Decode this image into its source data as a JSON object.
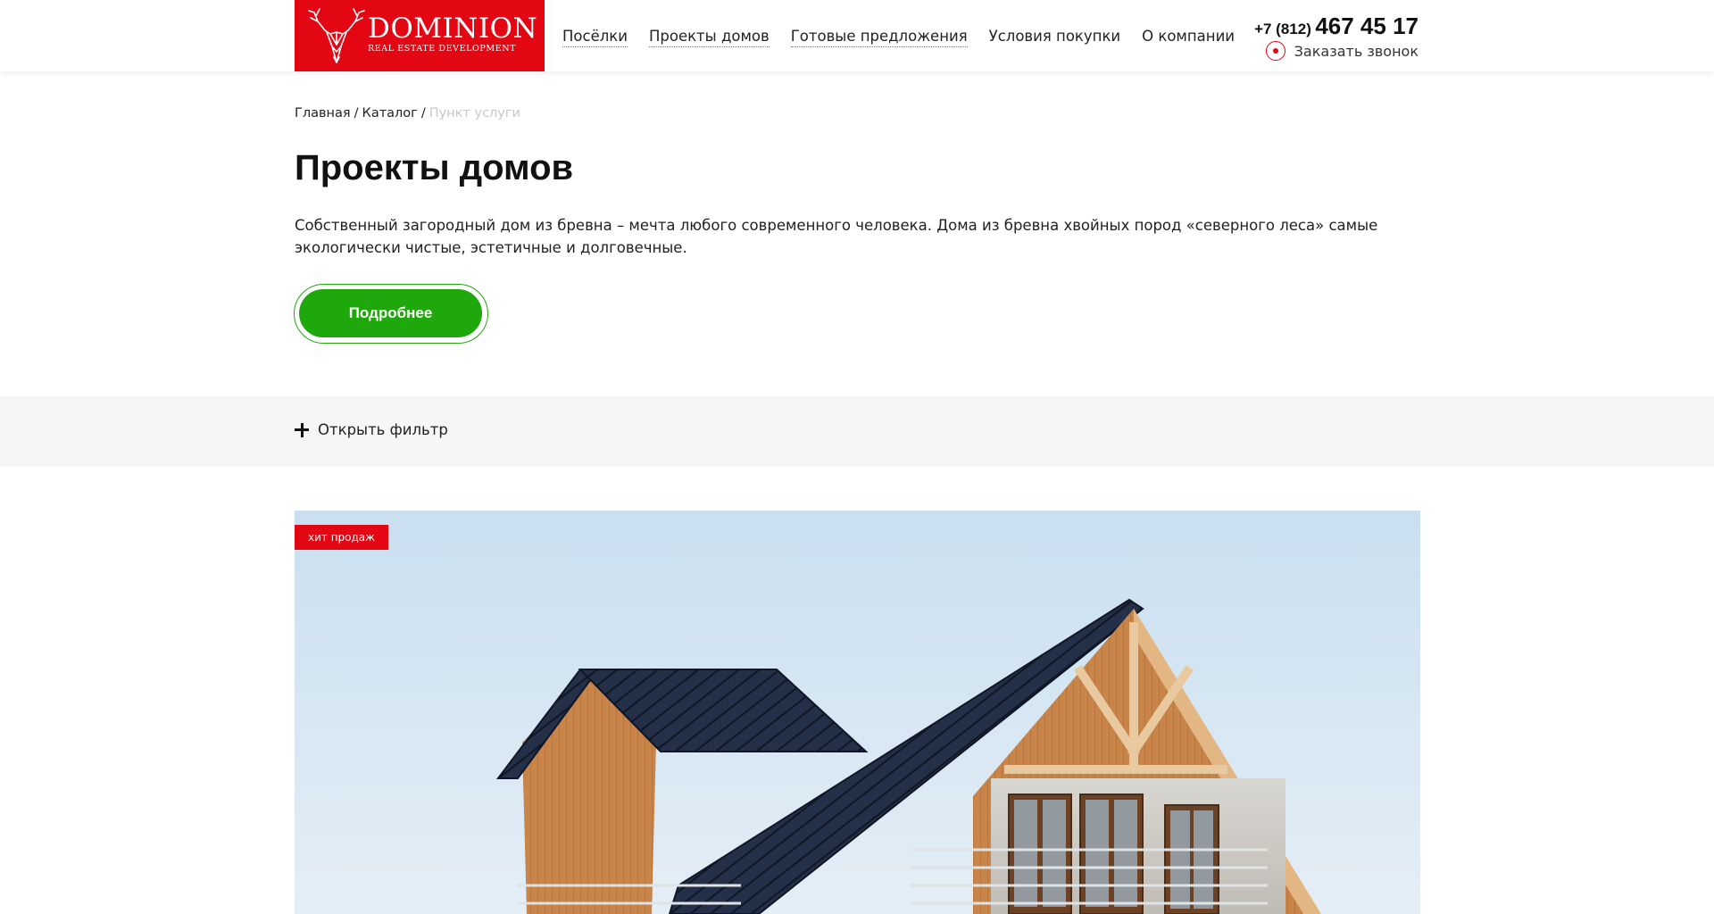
{
  "header": {
    "logo": {
      "title": "DOMINION",
      "subtitle": "REAL ESTATE DEVELOPMENT",
      "brand_color": "#e30613"
    },
    "nav": [
      {
        "label": "Посёлки"
      },
      {
        "label": "Проекты домов"
      },
      {
        "label": "Готовые предложения"
      },
      {
        "label": "Условия покупки"
      },
      {
        "label": "О компании"
      }
    ],
    "phone": {
      "code": "+7 (812)",
      "number": "467 45 17"
    },
    "callback": {
      "label": "Заказать звонок",
      "icon": "record-icon"
    }
  },
  "breadcrumb": {
    "items": [
      "Главная",
      "Каталог"
    ],
    "separator": "/",
    "current": "Пункт услуги"
  },
  "main": {
    "title": "Проекты домов",
    "intro": "Собственный загородный дом из бревна – мечта любого современного человека. Дома из бревна хвойных пород «северного леса» самые экологически чистые, эстетичные и долговечные.",
    "more_button": "Подробнее",
    "accent_color": "#1fa80b"
  },
  "filter": {
    "label": "Открыть фильтр",
    "icon": "plus-icon"
  },
  "card": {
    "badge": "хит продаж",
    "image": "house-photo"
  }
}
